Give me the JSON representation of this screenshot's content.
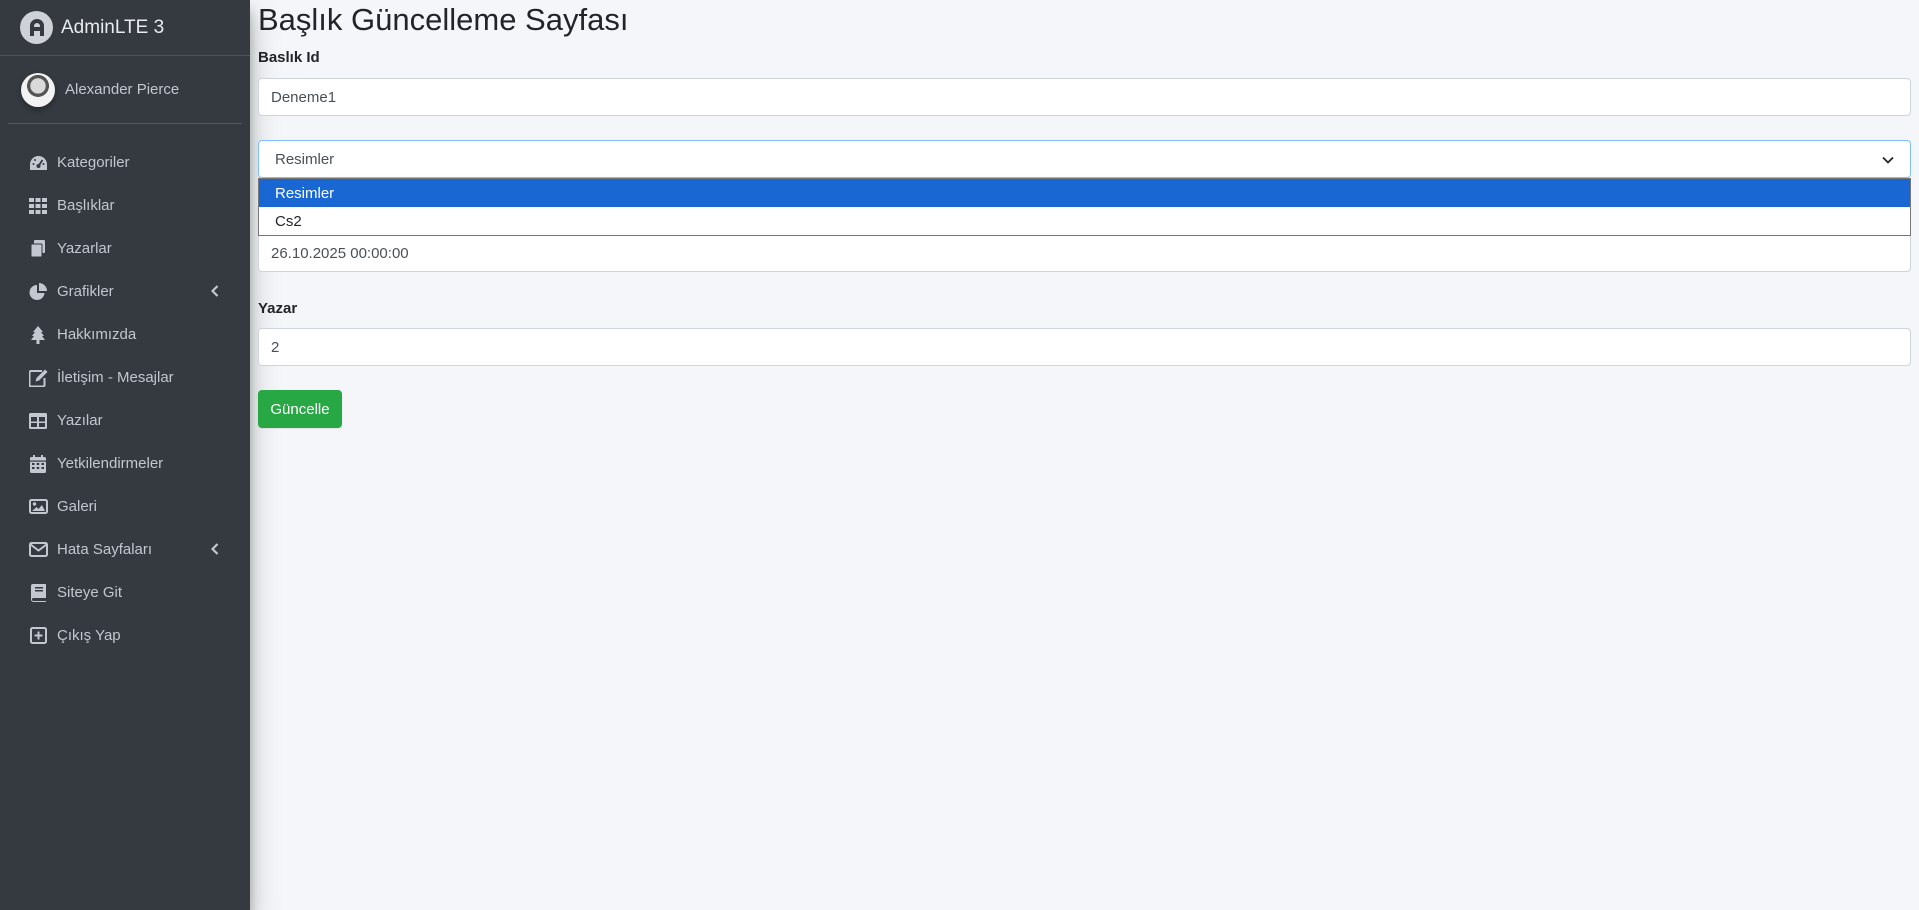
{
  "brand": {
    "title": "AdminLTE 3"
  },
  "user": {
    "name": "Alexander Pierce"
  },
  "sidebar": {
    "items": [
      {
        "label": "Kategoriler",
        "icon": "tachometer-icon"
      },
      {
        "label": "Başlıklar",
        "icon": "th-grid-icon"
      },
      {
        "label": "Yazarlar",
        "icon": "copy-icon"
      },
      {
        "label": "Grafikler",
        "icon": "chart-pie-icon",
        "has_submenu": true
      },
      {
        "label": "Hakkımızda",
        "icon": "tree-icon"
      },
      {
        "label": "İletişim - Mesajlar",
        "icon": "edit-icon"
      },
      {
        "label": "Yazılar",
        "icon": "table-icon"
      },
      {
        "label": "Yetkilendirmeler",
        "icon": "calendar-icon"
      },
      {
        "label": "Galeri",
        "icon": "image-icon"
      },
      {
        "label": "Hata Sayfaları",
        "icon": "envelope-icon",
        "has_submenu": true
      },
      {
        "label": "Siteye Git",
        "icon": "book-icon"
      },
      {
        "label": "Çıkış Yap",
        "icon": "plus-square-icon"
      }
    ]
  },
  "page": {
    "title": "Başlık Güncelleme Sayfası",
    "form": {
      "baslik_id_label": "Baslık Id",
      "baslik_id_value": "Deneme1",
      "category_select": {
        "selected": "Resimler",
        "options": [
          "Resimler",
          "Cs2"
        ]
      },
      "date_value": "26.10.2025 00:00:00",
      "yazar_label": "Yazar",
      "yazar_value": "2",
      "submit_label": "Güncelle"
    }
  },
  "colors": {
    "sidebar_bg": "#343a40",
    "content_bg": "#f4f6f9",
    "success": "#28a745",
    "dropdown_highlight": "#1967d2"
  }
}
